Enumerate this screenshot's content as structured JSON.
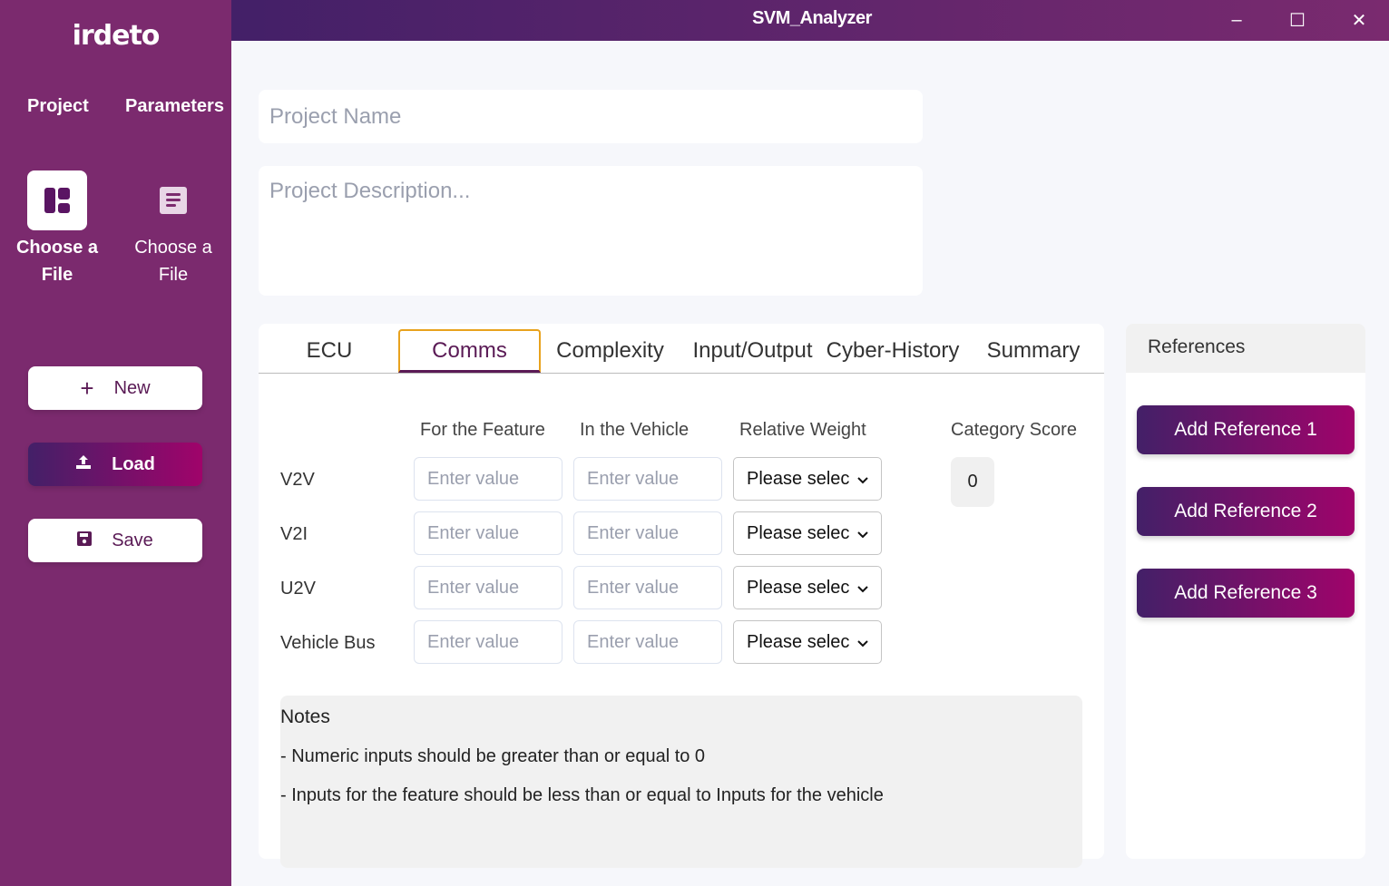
{
  "window": {
    "title": "SVM_Analyzer",
    "controls": {
      "minimize": "–",
      "maximize": "☐",
      "close": "✕"
    }
  },
  "sidebar": {
    "logo": "irdeto",
    "tabs": [
      {
        "label": "Project"
      },
      {
        "label": "Parameters"
      }
    ],
    "file_cards": [
      {
        "label": "Choose a File",
        "icon": "dashboard-icon",
        "active": true
      },
      {
        "label": "Choose a File",
        "icon": "document-icon",
        "active": false
      }
    ],
    "buttons": {
      "new": {
        "label": "New",
        "icon": "plus-icon"
      },
      "load": {
        "label": "Load",
        "icon": "upload-icon"
      },
      "save": {
        "label": "Save",
        "icon": "floppy-icon"
      }
    }
  },
  "project": {
    "name_placeholder": "Project Name",
    "name_value": "",
    "description_placeholder": "Project Description...",
    "description_value": ""
  },
  "main": {
    "tabs": [
      {
        "label": "ECU",
        "active": false
      },
      {
        "label": "Comms",
        "active": true
      },
      {
        "label": "Complexity",
        "active": false
      },
      {
        "label": "Input/Output",
        "active": false
      },
      {
        "label": "Cyber-History",
        "active": false
      },
      {
        "label": "Summary",
        "active": false
      }
    ],
    "columns": {
      "feature": "For the Feature",
      "vehicle": "In the Vehicle",
      "weight": "Relative Weight",
      "score": "Category Score"
    },
    "input_placeholder": "Enter value",
    "rows": [
      {
        "label": "V2V",
        "feature": "",
        "vehicle": "",
        "weight": "Please selec"
      },
      {
        "label": "V2I",
        "feature": "",
        "vehicle": "",
        "weight": "Please selec"
      },
      {
        "label": "U2V",
        "feature": "",
        "vehicle": "",
        "weight": "Please selec"
      },
      {
        "label": "Vehicle Bus",
        "feature": "",
        "vehicle": "",
        "weight": "Please selec"
      }
    ],
    "category_score": "0",
    "notes": {
      "title": "Notes",
      "lines": [
        "- Numeric inputs should be greater than or equal to 0",
        "- Inputs for the feature should be less than or equal to Inputs for the vehicle"
      ]
    }
  },
  "references": {
    "title": "References",
    "buttons": [
      "Add Reference 1",
      "Add Reference 2",
      "Add Reference 3"
    ]
  },
  "colors": {
    "sidebar_bg": "#7b2a6e",
    "accent_dark": "#432068",
    "accent_magenta": "#a0036a",
    "active_tab_border": "#e8a21d",
    "active_tab_text": "#5a1a55"
  }
}
